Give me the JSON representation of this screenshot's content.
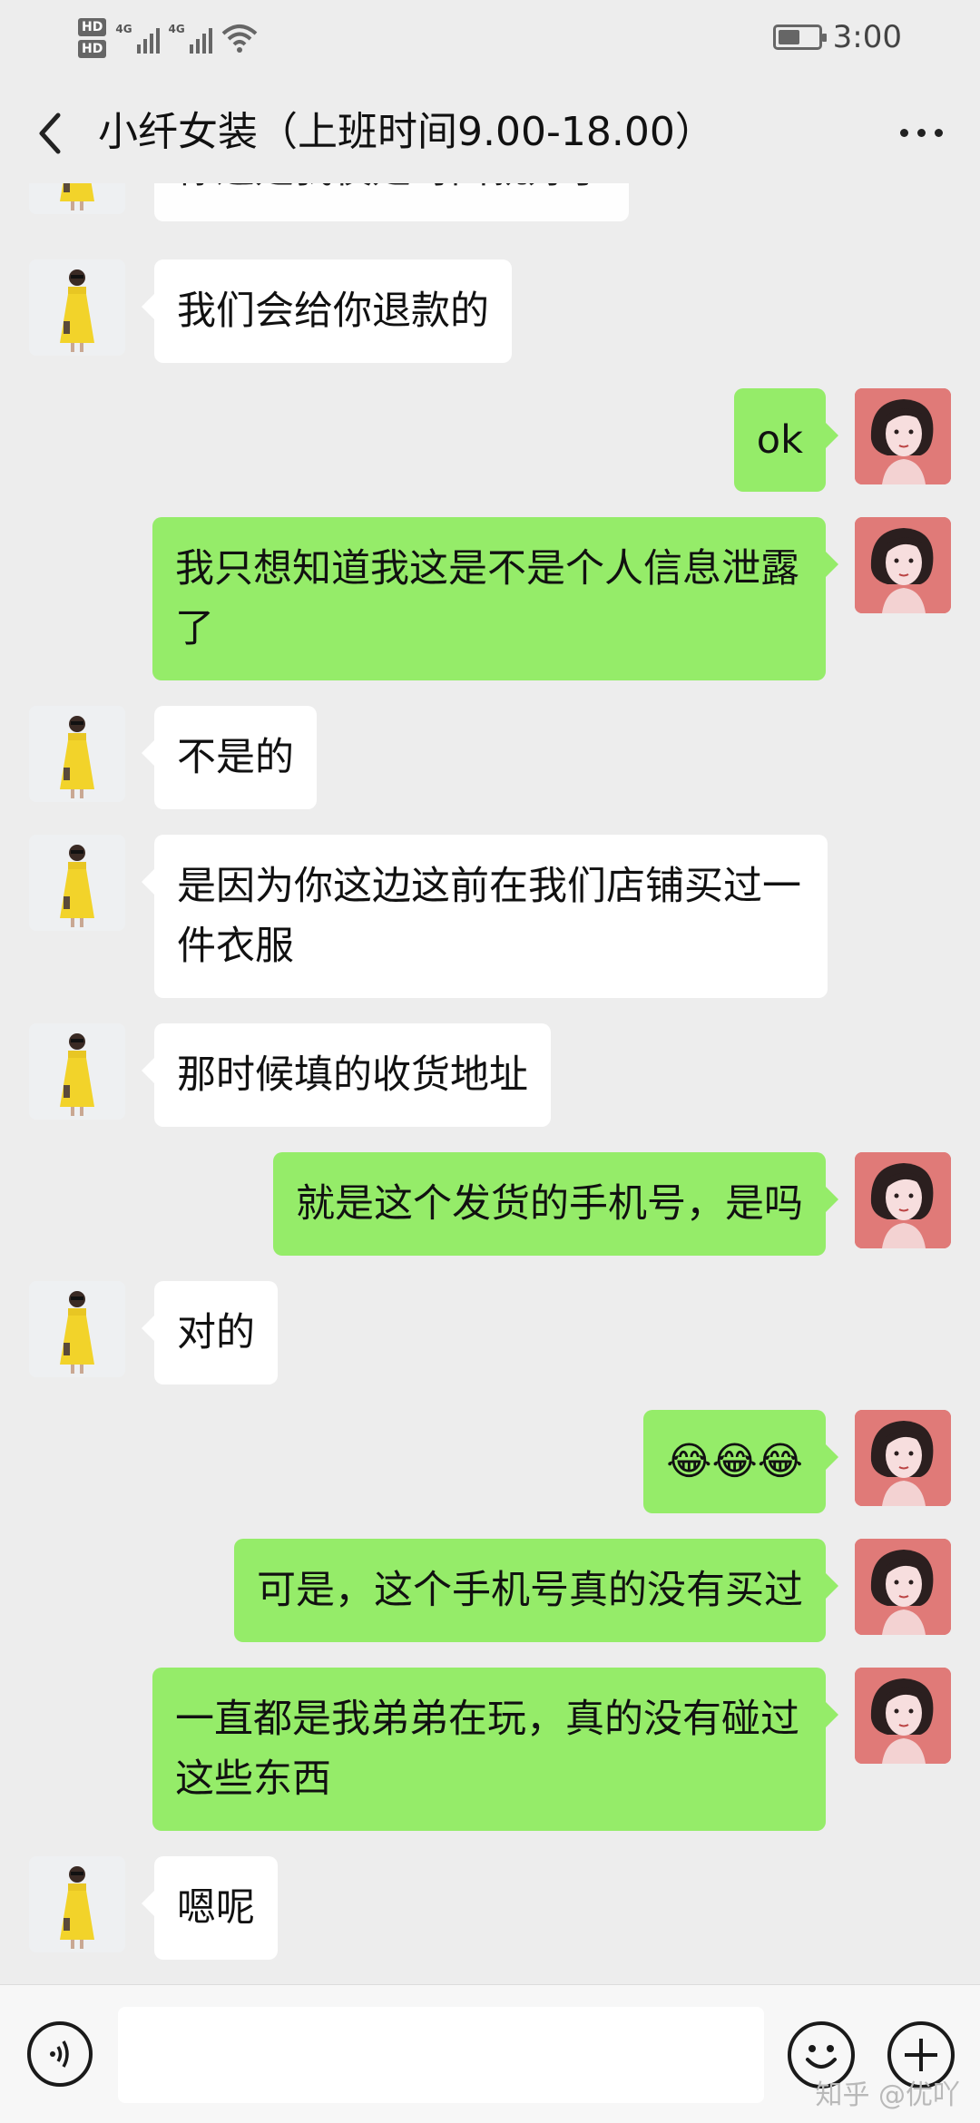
{
  "status_bar": {
    "hd1": "HD",
    "hd2": "HD",
    "net1": "4G",
    "net2": "4G",
    "time": "3:00",
    "battery_level": 0.55
  },
  "header": {
    "title": "小纤女装（上班时间9.00-18.00）"
  },
  "messages": [
    {
      "from": "shop",
      "text": "你这是我夜是哥面就好了"
    },
    {
      "from": "shop",
      "text": "我们会给你退款的"
    },
    {
      "from": "me",
      "text": "ok"
    },
    {
      "from": "me",
      "text": "我只想知道我这是不是个人信息泄露了"
    },
    {
      "from": "shop",
      "text": "不是的"
    },
    {
      "from": "shop",
      "text": "是因为你这边这前在我们店铺买过一件衣服"
    },
    {
      "from": "shop",
      "text": "那时候填的收货地址"
    },
    {
      "from": "me",
      "text": "就是这个发货的手机号，是吗"
    },
    {
      "from": "shop",
      "text": "对的"
    },
    {
      "from": "me",
      "text": "😂😂😂"
    },
    {
      "from": "me",
      "text": "可是，这个手机号真的没有买过"
    },
    {
      "from": "me",
      "text": "一直都是我弟弟在玩，真的没有碰过这些东西"
    },
    {
      "from": "shop",
      "text": "嗯呢"
    }
  ],
  "input_bar": {
    "text_value": "",
    "watermark": "知乎 @优吖"
  },
  "colors": {
    "background": "#ededed",
    "outgoing_bubble": "#95ec69",
    "incoming_bubble": "#ffffff"
  },
  "icons": {
    "back": "chevron-left-icon",
    "more": "more-dots-icon",
    "voice": "voice-icon",
    "emoji": "emoji-icon",
    "plus": "plus-icon"
  }
}
